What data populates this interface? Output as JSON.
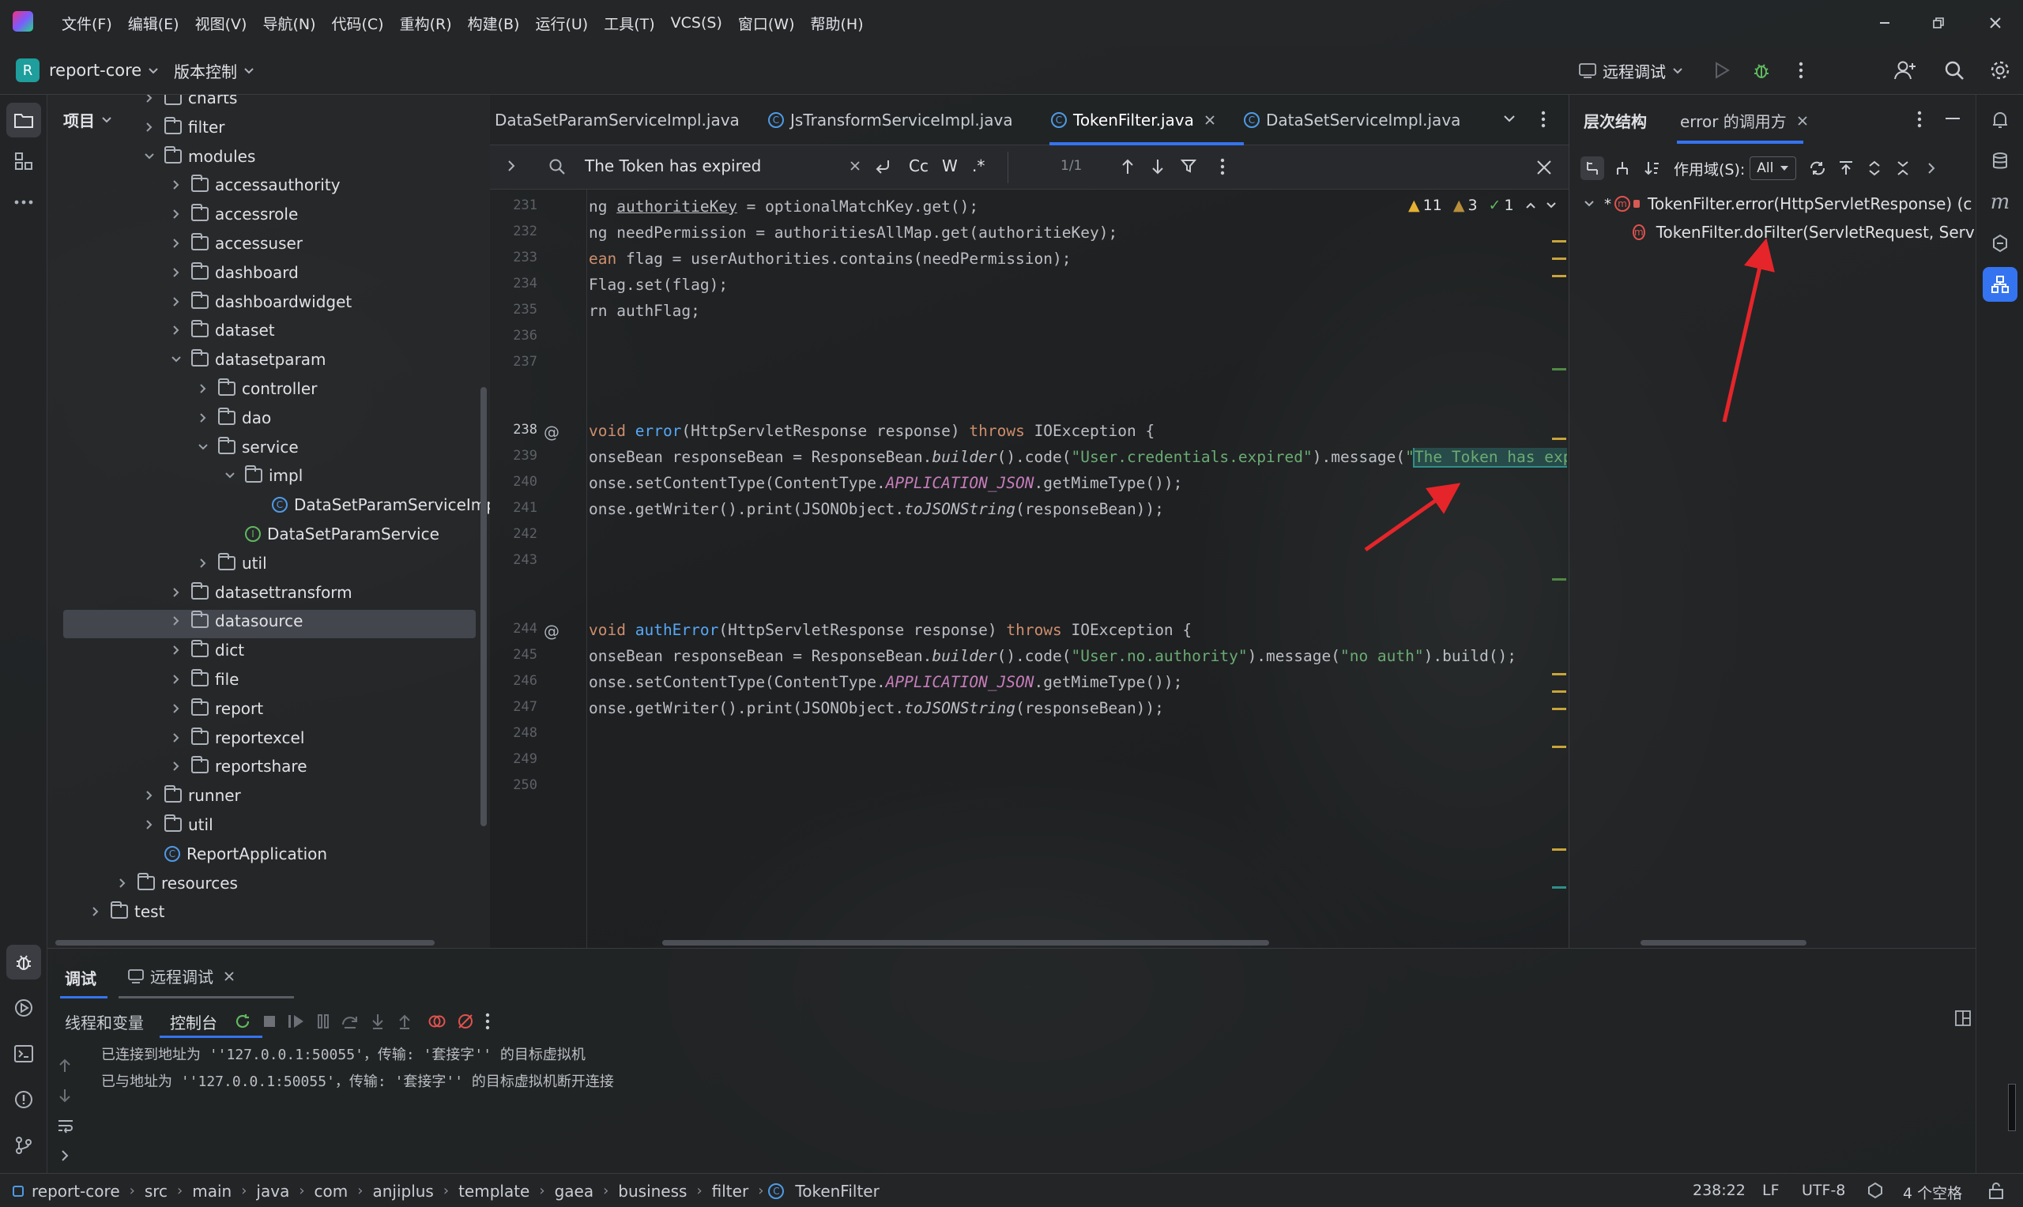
{
  "titlebar": {
    "menus": [
      "文件(F)",
      "编辑(E)",
      "视图(V)",
      "导航(N)",
      "代码(C)",
      "重构(R)",
      "构建(B)",
      "运行(U)",
      "工具(T)",
      "VCS(S)",
      "窗口(W)",
      "帮助(H)"
    ]
  },
  "toolbar": {
    "project_letter": "R",
    "project": "report-core",
    "vcs": "版本控制",
    "run_config": "远程调试"
  },
  "project_panel": {
    "title": "项目",
    "items": [
      "charts",
      "filter",
      "modules",
      "accessauthority",
      "accessrole",
      "accessuser",
      "dashboard",
      "dashboardwidget",
      "dataset",
      "datasetparam",
      "controller",
      "dao",
      "service",
      "impl",
      "DataSetParamServiceImp",
      "DataSetParamService",
      "util",
      "datasettransform",
      "datasource",
      "dict",
      "file",
      "report",
      "reportexcel",
      "reportshare",
      "runner",
      "util",
      "ReportApplication",
      "resources",
      "test"
    ]
  },
  "editor": {
    "tabs": [
      "DataSetParamServiceImpl.java",
      "JsTransformServiceImpl.java",
      "TokenFilter.java",
      "DataSetServiceImpl.java"
    ],
    "find": {
      "query": "The Token has expired",
      "match_case": "Cc",
      "words": "W",
      "regex": ".*",
      "count": "1/1"
    },
    "inspections": {
      "warnings": "11",
      "weak_warnings": "3",
      "ok": "1"
    },
    "line_numbers": [
      "231",
      "232",
      "233",
      "234",
      "235",
      "236",
      "237",
      "238",
      "239",
      "240",
      "241",
      "242",
      "243",
      "244",
      "245",
      "246",
      "247",
      "248",
      "249",
      "250"
    ]
  },
  "hierarchy": {
    "tab1": "层次结构",
    "tab2": "error 的调用方",
    "scope_label": "作用域(S):",
    "scope_value": "All",
    "node1": "TokenFilter.error(HttpServletResponse) (c",
    "node2": "TokenFilter.doFilter(ServletRequest, Servl"
  },
  "bottom": {
    "tab_debug": "调试",
    "tab_remote": "远程调试",
    "sub_threads": "线程和变量",
    "sub_console": "控制台",
    "lines": [
      "已连接到地址为 ''127.0.0.1:50055'，传输: '套接字'' 的目标虚拟机",
      "已与地址为 ''127.0.0.1:50055'，传输: '套接字'' 的目标虚拟机断开连接"
    ]
  },
  "statusbar": {
    "crumbs": [
      "report-core",
      "src",
      "main",
      "java",
      "com",
      "anjiplus",
      "template",
      "gaea",
      "business",
      "filter",
      "TokenFilter"
    ],
    "position": "238:22",
    "line_ending": "LF",
    "encoding": "UTF-8",
    "indent": "4 个空格"
  },
  "colors": {
    "accent": "#3574f0",
    "arrow": "#e5252a",
    "highlight_box": "#2f8f8a"
  }
}
